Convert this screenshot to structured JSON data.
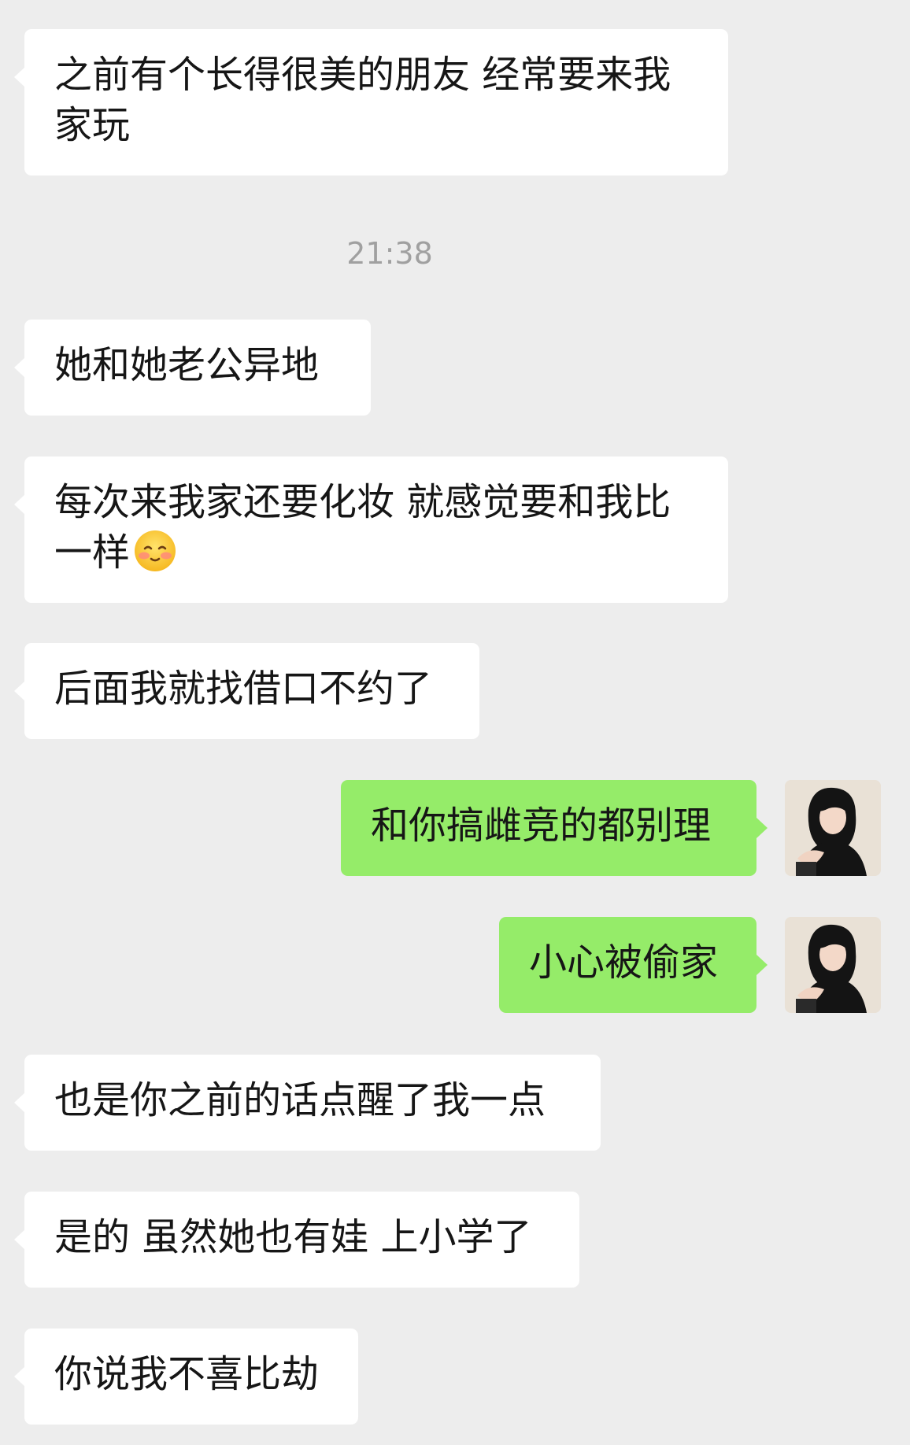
{
  "timestamp": "21:38",
  "messages": [
    {
      "text": "之前有个长得很美的朋友 经常要来我家玩",
      "side": "incoming"
    },
    {
      "text": "她和她老公异地",
      "side": "incoming"
    },
    {
      "text": "每次来我家还要化妆 就感觉要和我比一样",
      "side": "incoming",
      "emoji": "blushing-smile-emoji"
    },
    {
      "text": "后面我就找借口不约了",
      "side": "incoming"
    },
    {
      "text": "和你搞雌竞的都别理",
      "side": "outgoing"
    },
    {
      "text": "小心被偷家",
      "side": "outgoing"
    },
    {
      "text": "也是你之前的话点醒了我一点",
      "side": "incoming"
    },
    {
      "text": "是的 虽然她也有娃 上小学了",
      "side": "incoming"
    },
    {
      "text": "你说我不喜比劫",
      "side": "incoming"
    }
  ],
  "colors": {
    "background": "#ededed",
    "incoming_bubble": "#ffffff",
    "outgoing_bubble": "#95ec69",
    "text": "#161616",
    "timestamp": "#a0a0a0"
  }
}
